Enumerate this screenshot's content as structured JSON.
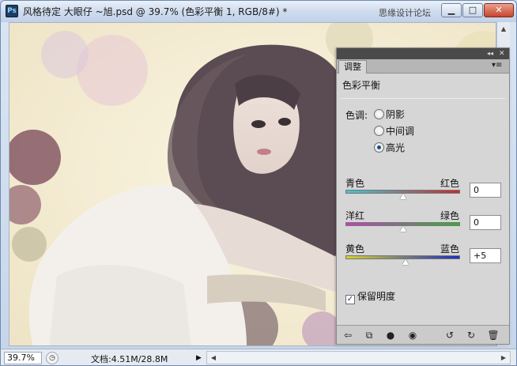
{
  "titlebar": {
    "app_icon": "Ps",
    "title": "风格待定 大眼仔 ~旭.psd @ 39.7% (色彩平衡 1, RGB/8#) *",
    "watermark": "思缘设计论坛",
    "minimize": "▁",
    "maximize": "□",
    "close": "✕"
  },
  "statusbar": {
    "zoom": "39.7%",
    "docinfo": "文档:4.51M/28.8M",
    "arrow": "▶"
  },
  "panel": {
    "collapse_glyph": "◂◂",
    "close_glyph": "✕",
    "tab": "调整",
    "menu_glyph": "▾≡",
    "adjustment_title": "色彩平衡",
    "tone_label": "色调:",
    "tones": [
      {
        "label": "阴影",
        "selected": false
      },
      {
        "label": "中间调",
        "selected": false
      },
      {
        "label": "高光",
        "selected": true
      }
    ],
    "sliders": [
      {
        "left": "青色",
        "right": "红色",
        "value": "0",
        "level": 0,
        "gradient": [
          "#41c6d6",
          "#c92b2b"
        ]
      },
      {
        "left": "洋红",
        "right": "绿色",
        "value": "0",
        "level": 0,
        "gradient": [
          "#c93bc9",
          "#2bb52b"
        ]
      },
      {
        "left": "黄色",
        "right": "蓝色",
        "value": "+5",
        "level": 5,
        "gradient": [
          "#d7d22b",
          "#1d2bc2"
        ]
      }
    ],
    "preserve_luminosity_label": "保留明度",
    "preserve_luminosity_checked": true,
    "bottom_icons": [
      "back-arrow-icon",
      "panel-view-icon",
      "clip-layer-icon",
      "eye-icon",
      "previous-state-icon",
      "reset-icon",
      "trash-icon"
    ]
  },
  "colors": {
    "panel_bg": "#d6d6d6",
    "panel_strip": "#4a4a4a",
    "canvas_bg": "#f5efd4"
  }
}
